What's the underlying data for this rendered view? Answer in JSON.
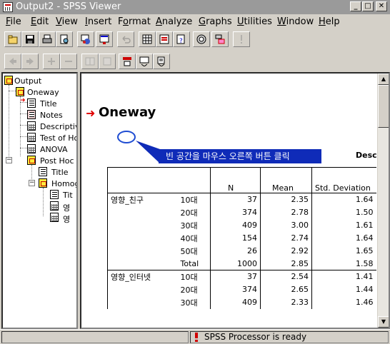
{
  "window": {
    "title": "Output2 - SPSS Viewer"
  },
  "menu": [
    {
      "label": "File",
      "key": "F"
    },
    {
      "label": "Edit",
      "key": "E"
    },
    {
      "label": "View",
      "key": "V"
    },
    {
      "label": "Insert",
      "key": "I"
    },
    {
      "label": "Format",
      "key": "o"
    },
    {
      "label": "Analyze",
      "key": "A"
    },
    {
      "label": "Graphs",
      "key": "G"
    },
    {
      "label": "Utilities",
      "key": "U"
    },
    {
      "label": "Window",
      "key": "W"
    },
    {
      "label": "Help",
      "key": "H"
    }
  ],
  "outline": {
    "root": "Output",
    "oneway": "Oneway",
    "title": "Title",
    "notes": "Notes",
    "descriptives": "Descriptive",
    "homogeneity": "Test of Ho",
    "anova": "ANOVA",
    "posthoc": "Post Hoc T",
    "posthoc_title": "Title",
    "homogeneous": "Homog",
    "homog_title": "Tit",
    "homog_1": "영",
    "homog_2": "영"
  },
  "content": {
    "heading": "Oneway",
    "callout": "빈 공간을 마우스 오른쪽 버튼 클릭",
    "table_title": "Descri",
    "columns": [
      "N",
      "Mean",
      "Std. Deviation"
    ],
    "rows": [
      {
        "group": "영향_친구",
        "cat": "10대",
        "n": "37",
        "mean": "2.35",
        "sd": "1.64"
      },
      {
        "group": "",
        "cat": "20대",
        "n": "374",
        "mean": "2.78",
        "sd": "1.50"
      },
      {
        "group": "",
        "cat": "30대",
        "n": "409",
        "mean": "3.00",
        "sd": "1.61"
      },
      {
        "group": "",
        "cat": "40대",
        "n": "154",
        "mean": "2.74",
        "sd": "1.64"
      },
      {
        "group": "",
        "cat": "50대",
        "n": "26",
        "mean": "2.92",
        "sd": "1.65"
      },
      {
        "group": "",
        "cat": "Total",
        "n": "1000",
        "mean": "2.85",
        "sd": "1.58"
      },
      {
        "group": "영향_인터넷",
        "cat": "10대",
        "n": "37",
        "mean": "2.54",
        "sd": "1.41"
      },
      {
        "group": "",
        "cat": "20대",
        "n": "374",
        "mean": "2.65",
        "sd": "1.44"
      },
      {
        "group": "",
        "cat": "30대",
        "n": "409",
        "mean": "2.33",
        "sd": "1.46"
      }
    ]
  },
  "status": {
    "text": "SPSS Processor  is ready"
  },
  "colors": {
    "callout_bg": "#0f2bb8",
    "ellipse": "#1e4cd2",
    "arrow": "#e00000"
  }
}
